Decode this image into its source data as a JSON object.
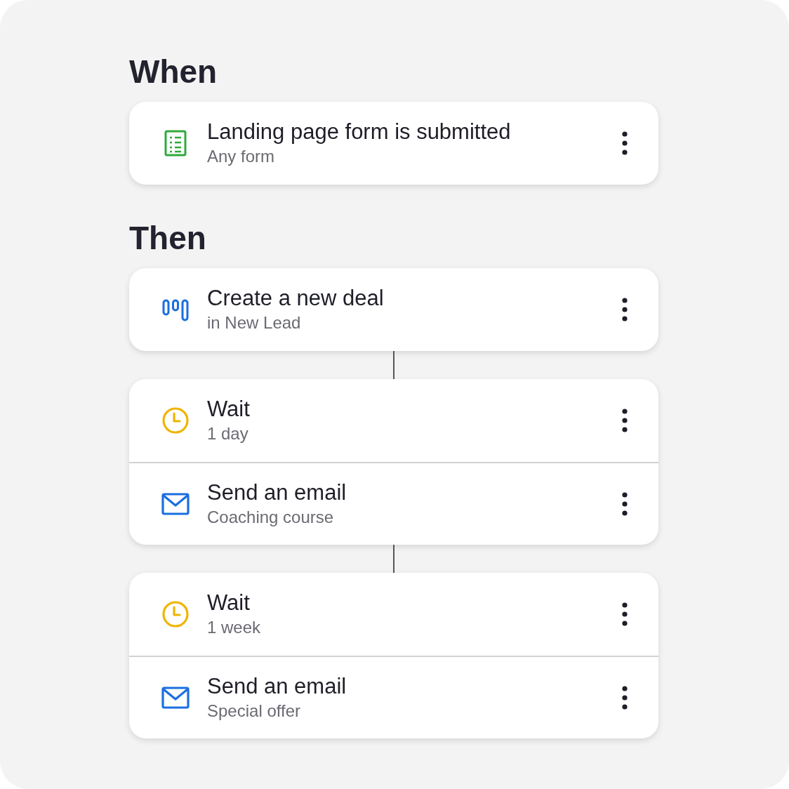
{
  "sections": [
    {
      "title": "When",
      "groups": [
        [
          {
            "kind": "form",
            "title": "Landing page form is submitted",
            "subtitle": "Any form"
          }
        ]
      ]
    },
    {
      "title": "Then",
      "groups": [
        [
          {
            "kind": "deal",
            "title": "Create a new deal",
            "subtitle": "in New Lead"
          }
        ],
        [
          {
            "kind": "wait",
            "title": "Wait",
            "subtitle": "1 day"
          },
          {
            "kind": "email",
            "title": "Send an email",
            "subtitle": "Coaching course"
          }
        ],
        [
          {
            "kind": "wait",
            "title": "Wait",
            "subtitle": "1 week"
          },
          {
            "kind": "email",
            "title": "Send an email",
            "subtitle": "Special offer"
          }
        ]
      ]
    }
  ]
}
